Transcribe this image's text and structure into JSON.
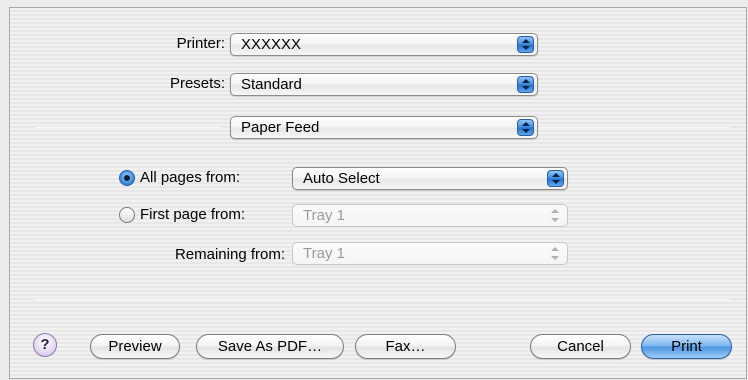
{
  "printer": {
    "label": "Printer:",
    "value": "XXXXXX"
  },
  "presets": {
    "label": "Presets:",
    "value": "Standard"
  },
  "panel": {
    "value": "Paper Feed"
  },
  "feed": {
    "all_pages": {
      "label": "All pages from:",
      "value": "Auto Select",
      "selected": true
    },
    "first_page": {
      "label": "First page from:",
      "value": "Tray 1",
      "selected": false
    },
    "remaining": {
      "label": "Remaining from:",
      "value": "Tray 1"
    }
  },
  "buttons": {
    "help": "?",
    "preview": "Preview",
    "save_as_pdf": "Save As PDF…",
    "fax": "Fax…",
    "cancel": "Cancel",
    "print": "Print"
  },
  "icons": {
    "popup_arrows": "updown-arrows-icon",
    "help": "help-icon"
  },
  "colors": {
    "accent": "#3a8fe0",
    "disabled_text": "#9a9a9a"
  }
}
